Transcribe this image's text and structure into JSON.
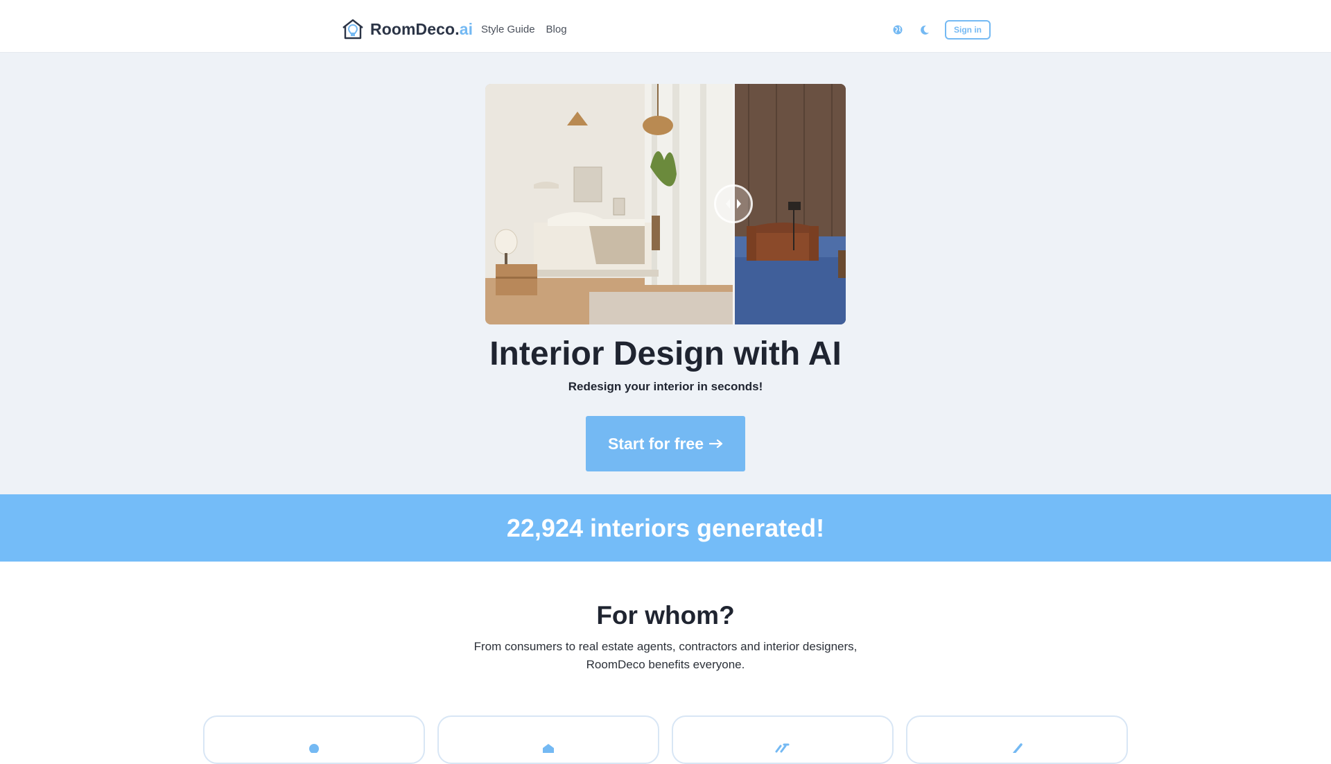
{
  "header": {
    "brand_main": "RoomDeco.",
    "brand_accent": "ai",
    "nav": [
      {
        "label": "Style Guide"
      },
      {
        "label": "Blog"
      }
    ],
    "sign_in_label": "Sign in",
    "language_icon": "globe-icon",
    "theme_icon": "moon-icon"
  },
  "hero": {
    "title": "Interior Design with AI",
    "subtitle": "Redesign your interior in seconds!",
    "cta_label": "Start for free",
    "cta_icon": "arrow-right-icon"
  },
  "counter": {
    "text": "22,924 interiors generated!"
  },
  "for_whom": {
    "title": "For whom?",
    "description_line1": "From consumers to real estate agents, contractors and interior designers,",
    "description_line2": "RoomDeco benefits everyone."
  },
  "colors": {
    "accent": "#74b9f3",
    "band": "#74bcf8",
    "hero_bg": "#eef2f7",
    "text": "#1f2430"
  }
}
